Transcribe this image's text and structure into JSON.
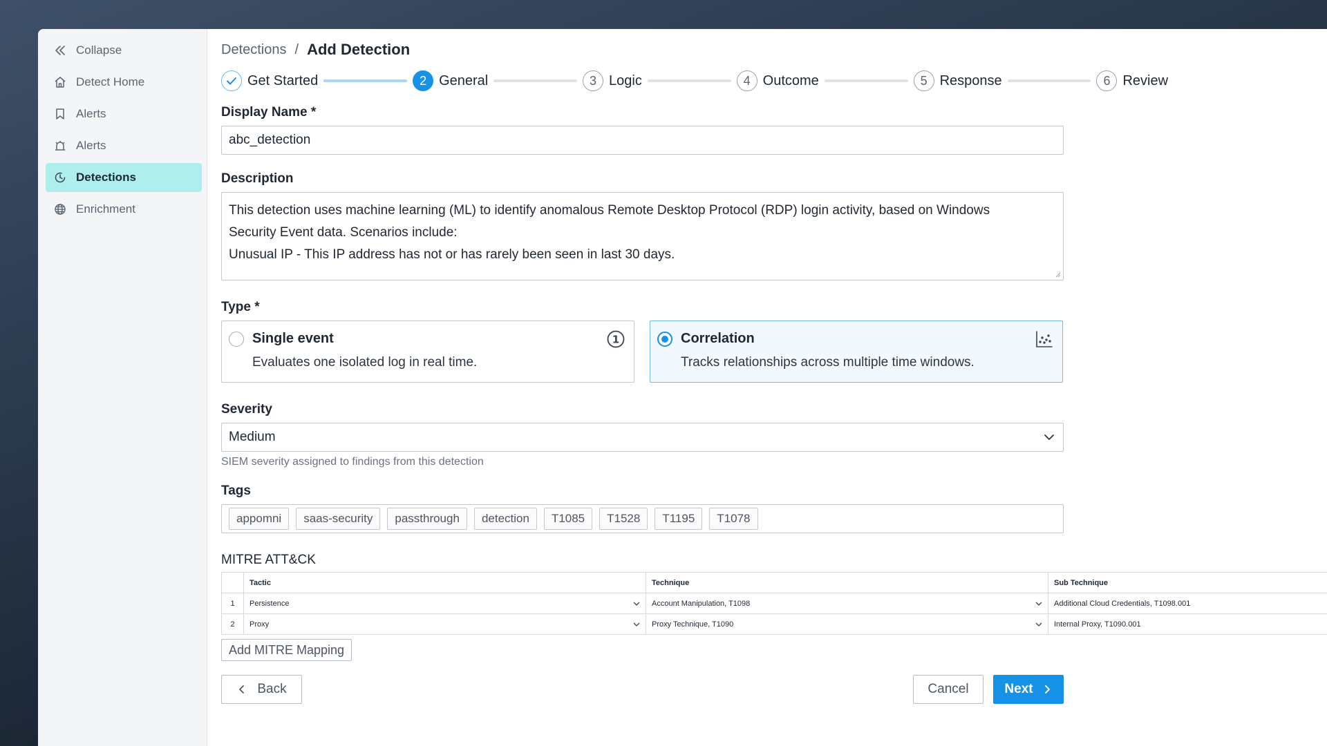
{
  "sidebar": {
    "collapse_label": "Collapse",
    "items": [
      {
        "label": "Detect Home",
        "icon": "home-icon"
      },
      {
        "label": "Alerts",
        "icon": "bookmark-icon"
      },
      {
        "label": "Alerts",
        "icon": "alarm-icon"
      },
      {
        "label": "Detections",
        "icon": "clock-icon",
        "active": true
      },
      {
        "label": "Enrichment",
        "icon": "globe-icon"
      }
    ]
  },
  "breadcrumb": {
    "parent": "Detections",
    "separator": "/",
    "current": "Add Detection"
  },
  "stepper": [
    {
      "number": "",
      "label": "Get Started",
      "state": "done"
    },
    {
      "number": "2",
      "label": "General",
      "state": "current"
    },
    {
      "number": "3",
      "label": "Logic",
      "state": "pending"
    },
    {
      "number": "4",
      "label": "Outcome",
      "state": "pending"
    },
    {
      "number": "5",
      "label": "Response",
      "state": "pending"
    },
    {
      "number": "6",
      "label": "Review",
      "state": "pending"
    }
  ],
  "form": {
    "display_name": {
      "label": "Display Name *",
      "value": "abc_detection"
    },
    "description": {
      "label": "Description",
      "lines": [
        "This detection uses machine learning (ML) to identify anomalous Remote Desktop Protocol (RDP) login activity, based on Windows",
        "Security Event data. Scenarios include:",
        "Unusual IP - This IP address has not or has rarely been seen in last 30 days."
      ]
    },
    "type": {
      "label": "Type *",
      "options": [
        {
          "title": "Single event",
          "desc": "Evaluates one isolated log in real time.",
          "selected": false
        },
        {
          "title": "Correlation",
          "desc": "Tracks relationships across multiple time windows.",
          "selected": true
        }
      ],
      "single_icon_text": "1"
    },
    "severity": {
      "label": "Severity",
      "value": "Medium",
      "helper": "SIEM severity assigned to findings from this detection"
    },
    "tags": {
      "label": "Tags",
      "items": [
        "appomni",
        "saas-security",
        "passthrough",
        "detection",
        "T1085",
        "T1528",
        "T1195",
        "T1078"
      ]
    },
    "mitre": {
      "label": "MITRE ATT&CK",
      "columns": [
        "Tactic",
        "Technique",
        "Sub Technique"
      ],
      "rows": [
        {
          "index": "1",
          "tactic": "Persistence",
          "technique": "Account Manipulation, T1098",
          "sub": "Additional Cloud Credentials, T1098.001"
        },
        {
          "index": "2",
          "tactic": "Proxy",
          "technique": "Proxy Technique, T1090",
          "sub": "Internal Proxy, T1090.001"
        }
      ],
      "add_label": "Add MITRE Mapping"
    }
  },
  "footer": {
    "back_label": "Back",
    "cancel_label": "Cancel",
    "next_label": "Next"
  },
  "colors": {
    "accent": "#1591e6",
    "active_nav": "#aeeeec",
    "selected_card": "#f1f8fe"
  }
}
